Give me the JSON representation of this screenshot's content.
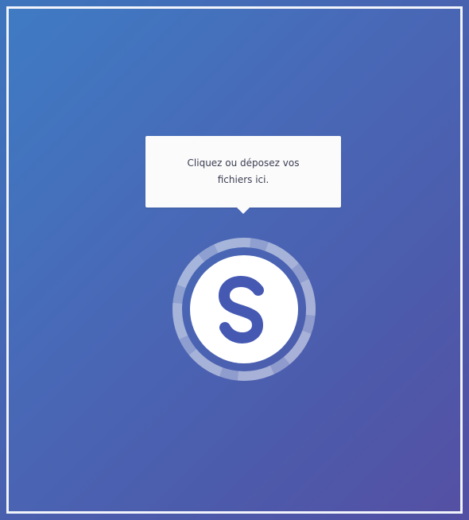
{
  "upload": {
    "tooltip_text": "Cliquez ou déposez vos fichiers ici.",
    "logo_letter": "S",
    "accent_color": "#4559b3",
    "background_gradient": [
      "#3f7bc3",
      "#5450a4"
    ]
  }
}
